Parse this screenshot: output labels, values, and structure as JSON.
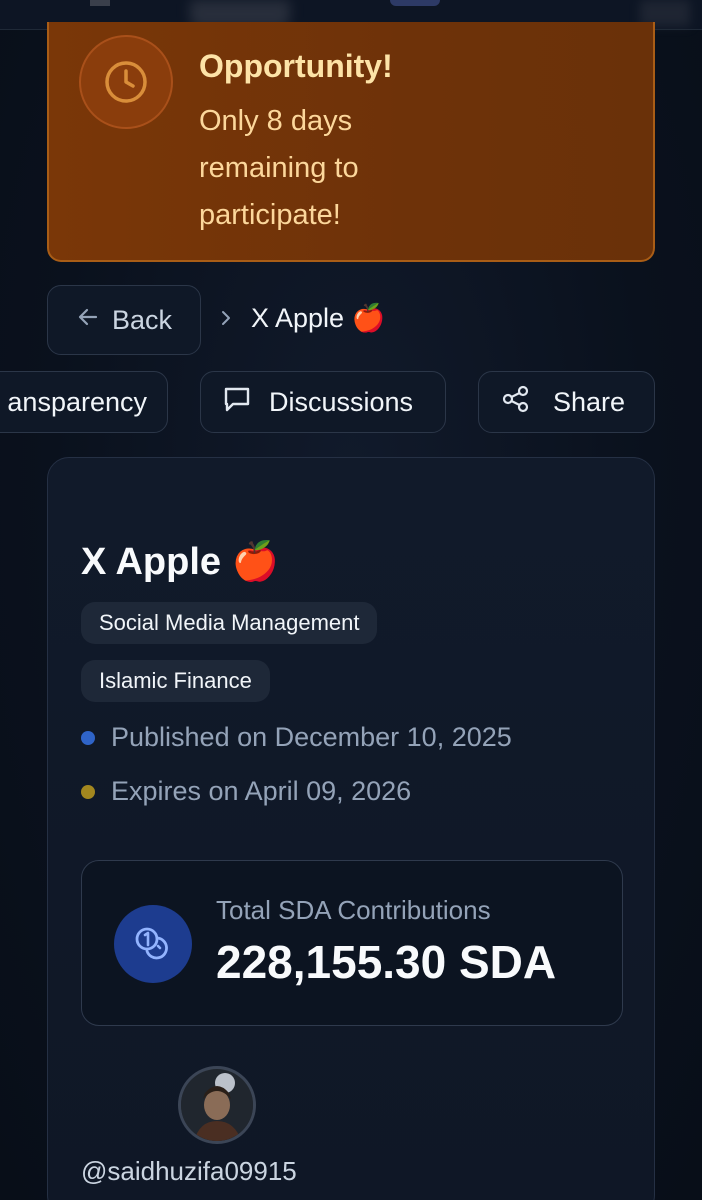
{
  "alert": {
    "title": "Opportunity!",
    "body": "Only 8 days remaining to participate!",
    "icon": "clock-icon",
    "color": "#7a3708"
  },
  "breadcrumb": {
    "back_label": "Back",
    "current": "X Apple 🍎"
  },
  "actions": {
    "transparency_label": "ansparency",
    "discussions_label": "Discussions",
    "share_label": "Share"
  },
  "campaign": {
    "title": "X Apple 🍎",
    "tags": [
      "Social Media Management",
      "Islamic Finance"
    ],
    "published": "Published on December 10, 2025",
    "expires": "Expires on April 09, 2026",
    "published_dot_color": "#2f64c8",
    "expires_dot_color": "#a3871f"
  },
  "contributions": {
    "label": "Total SDA Contributions",
    "value": "228,155.30 SDA",
    "icon": "coins-icon"
  },
  "creator": {
    "username": "@saidhuzifa09915"
  }
}
